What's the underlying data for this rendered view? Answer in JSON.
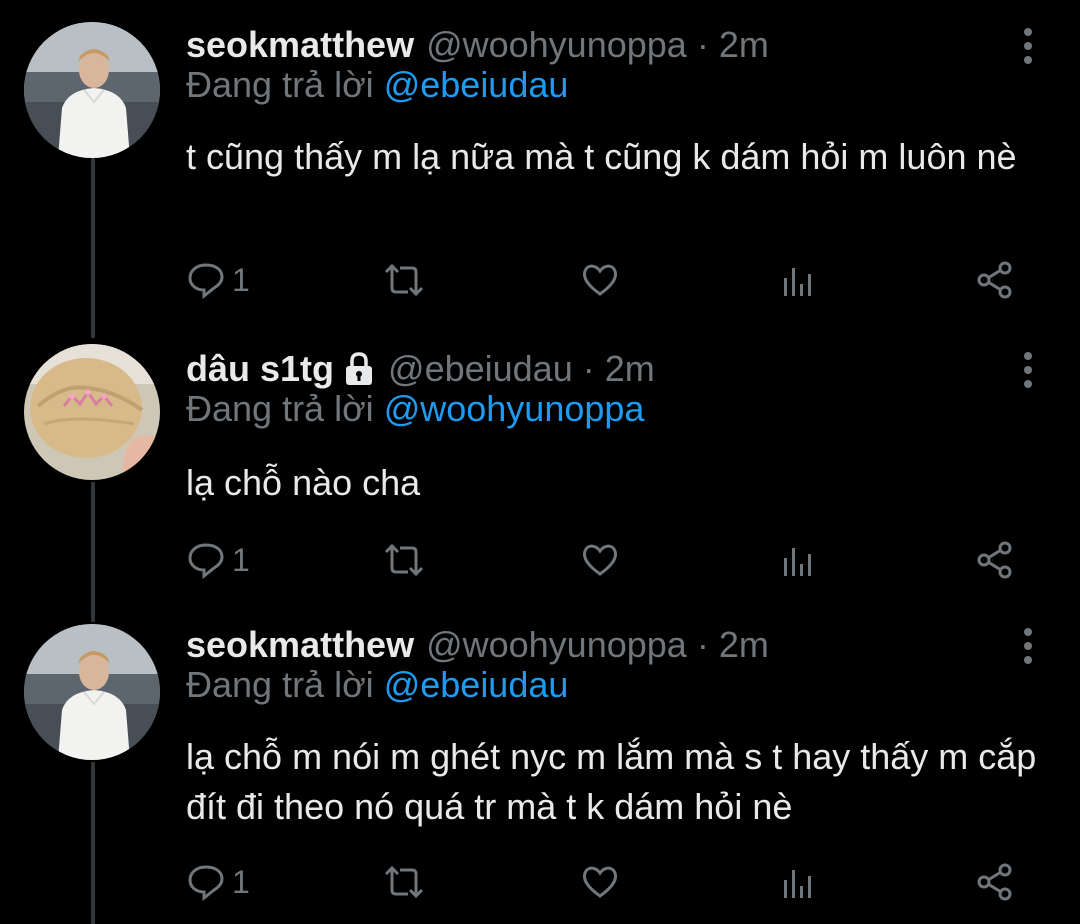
{
  "colors": {
    "background": "#000000",
    "primary_text": "#e7e9ea",
    "secondary_text": "#71767b",
    "mention": "#1d9bf0",
    "thread_line": "#333639"
  },
  "replying_label": "Đang trả lời",
  "separator": "·",
  "tweets": [
    {
      "display_name": "seokmatthew",
      "handle": "@woohyunoppa",
      "time": "2m",
      "replying_to": "@ebeiudau",
      "text": "t cũng thấy m lạ nữa mà t cũng k dám hỏi m luôn nè",
      "reply_count": "1",
      "protected": false,
      "avatar": "photo of person in white sweatshirt by the sea"
    },
    {
      "display_name": "dâu s1tg",
      "handle": "@ebeiudau",
      "time": "2m",
      "replying_to": "@woohyunoppa",
      "text": "lạ chỗ nào cha",
      "reply_count": "1",
      "protected": true,
      "avatar": "photo of blonde hair with tiara"
    },
    {
      "display_name": "seokmatthew",
      "handle": "@woohyunoppa",
      "time": "2m",
      "replying_to": "@ebeiudau",
      "text": "lạ chỗ m nói m ghét nyc m lắm mà s t hay thấy m cắp đít đi theo nó quá tr mà t k dám hỏi nè",
      "reply_count": "1",
      "protected": false,
      "avatar": "photo of person in white sweatshirt by the sea"
    }
  ],
  "icons": {
    "reply": "reply-icon",
    "retweet": "retweet-icon",
    "like": "heart-icon",
    "analytics": "analytics-icon",
    "share": "share-icon",
    "more": "more-vertical-icon",
    "lock": "lock-icon"
  }
}
